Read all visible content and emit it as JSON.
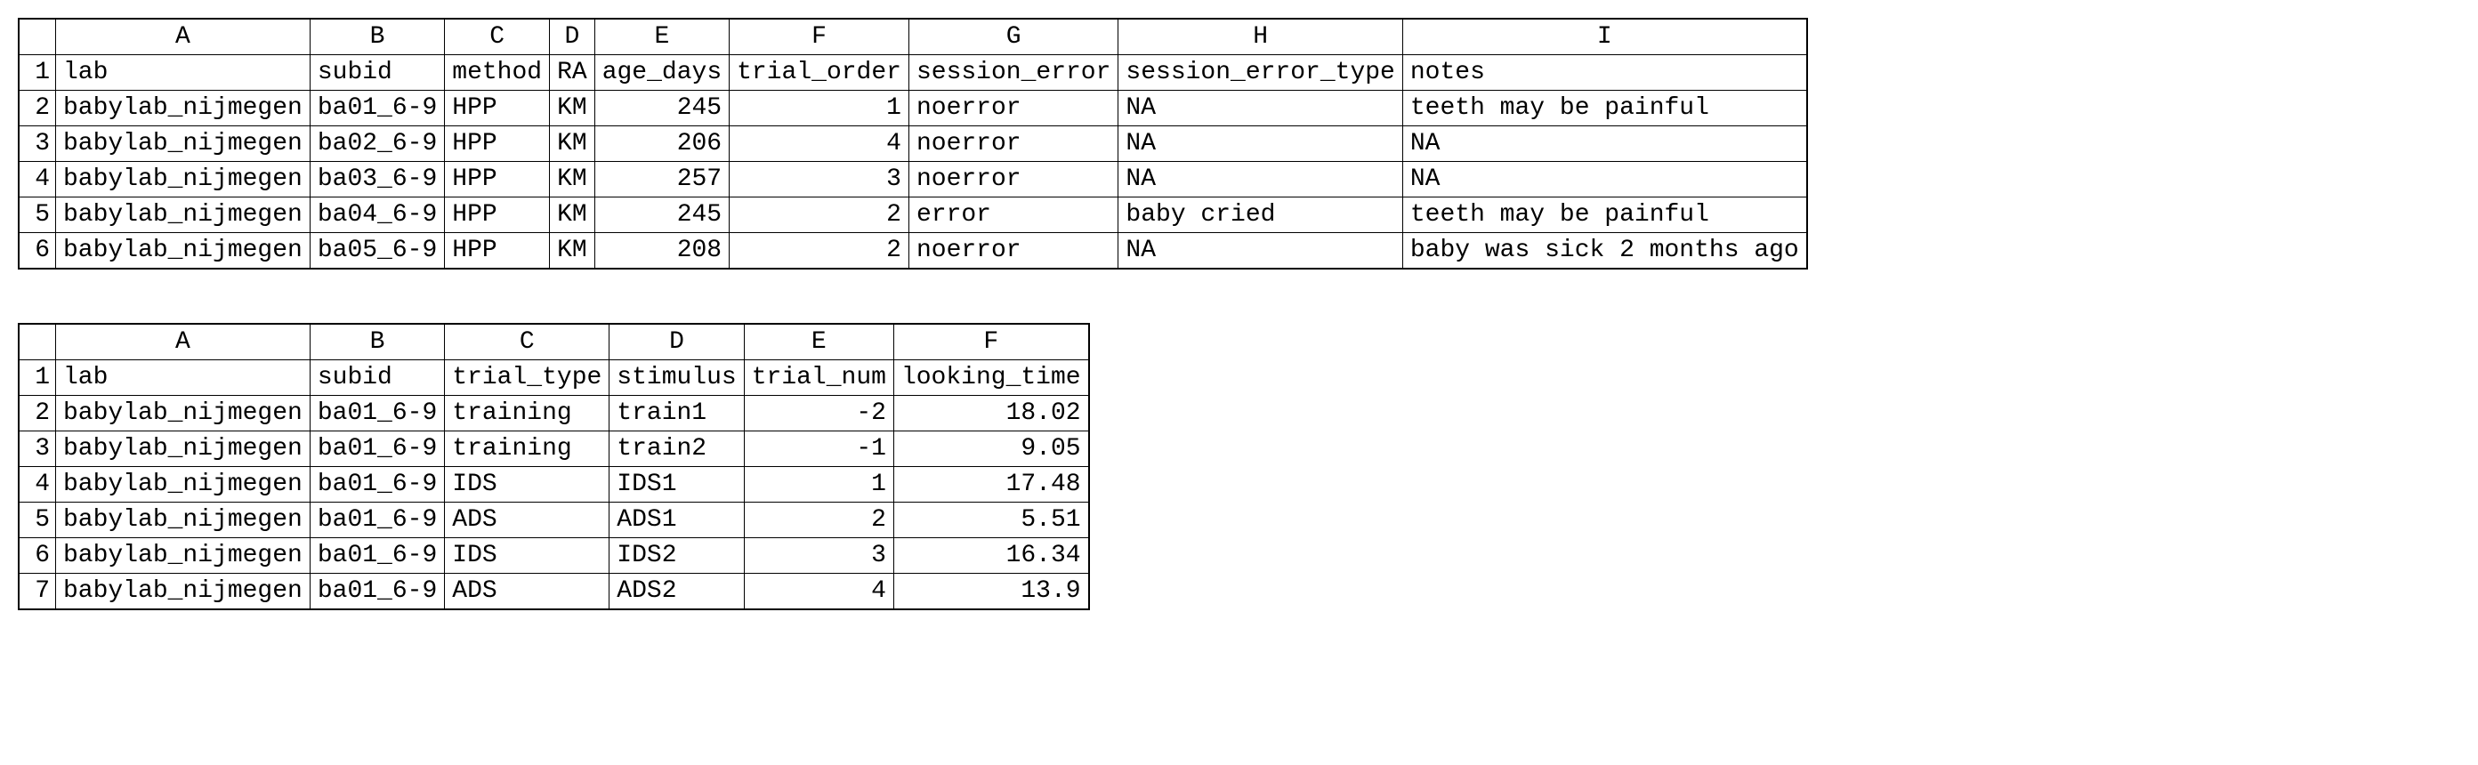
{
  "tables": [
    {
      "id": "table1",
      "columns": [
        "A",
        "B",
        "C",
        "D",
        "E",
        "F",
        "G",
        "H",
        "I"
      ],
      "col_align": [
        "left",
        "left",
        "left",
        "left",
        "right",
        "right",
        "left",
        "left",
        "left"
      ],
      "rows": [
        {
          "n": "1",
          "cells": [
            "lab",
            "subid",
            "method",
            "RA",
            "age_days",
            "trial_order",
            "session_error",
            "session_error_type",
            "notes"
          ],
          "align_override": {
            "4": "left",
            "5": "left"
          }
        },
        {
          "n": "2",
          "cells": [
            "babylab_nijmegen",
            "ba01_6-9",
            "HPP",
            "KM",
            "245",
            "1",
            "noerror",
            "NA",
            "teeth may be painful"
          ]
        },
        {
          "n": "3",
          "cells": [
            "babylab_nijmegen",
            "ba02_6-9",
            "HPP",
            "KM",
            "206",
            "4",
            "noerror",
            "NA",
            "NA"
          ]
        },
        {
          "n": "4",
          "cells": [
            "babylab_nijmegen",
            "ba03_6-9",
            "HPP",
            "KM",
            "257",
            "3",
            "noerror",
            "NA",
            "NA"
          ]
        },
        {
          "n": "5",
          "cells": [
            "babylab_nijmegen",
            "ba04_6-9",
            "HPP",
            "KM",
            "245",
            "2",
            "error",
            "baby cried",
            "teeth may be painful"
          ]
        },
        {
          "n": "6",
          "cells": [
            "babylab_nijmegen",
            "ba05_6-9",
            "HPP",
            "KM",
            "208",
            "2",
            "noerror",
            "NA",
            "baby was sick 2 months ago"
          ]
        }
      ]
    },
    {
      "id": "table2",
      "columns": [
        "A",
        "B",
        "C",
        "D",
        "E",
        "F"
      ],
      "col_align": [
        "left",
        "left",
        "left",
        "left",
        "right",
        "right"
      ],
      "rows": [
        {
          "n": "1",
          "cells": [
            "lab",
            "subid",
            "trial_type",
            "stimulus",
            "trial_num",
            "looking_time"
          ],
          "align_override": {
            "4": "left",
            "5": "left"
          }
        },
        {
          "n": "2",
          "cells": [
            "babylab_nijmegen",
            "ba01_6-9",
            "training",
            "train1",
            "-2",
            "18.02"
          ]
        },
        {
          "n": "3",
          "cells": [
            "babylab_nijmegen",
            "ba01_6-9",
            "training",
            "train2",
            "-1",
            "9.05"
          ]
        },
        {
          "n": "4",
          "cells": [
            "babylab_nijmegen",
            "ba01_6-9",
            "IDS",
            "IDS1",
            "1",
            "17.48"
          ]
        },
        {
          "n": "5",
          "cells": [
            "babylab_nijmegen",
            "ba01_6-9",
            "ADS",
            "ADS1",
            "2",
            "5.51"
          ]
        },
        {
          "n": "6",
          "cells": [
            "babylab_nijmegen",
            "ba01_6-9",
            "IDS",
            "IDS2",
            "3",
            "16.34"
          ]
        },
        {
          "n": "7",
          "cells": [
            "babylab_nijmegen",
            "ba01_6-9",
            "ADS",
            "ADS2",
            "4",
            "13.9"
          ]
        }
      ]
    }
  ]
}
